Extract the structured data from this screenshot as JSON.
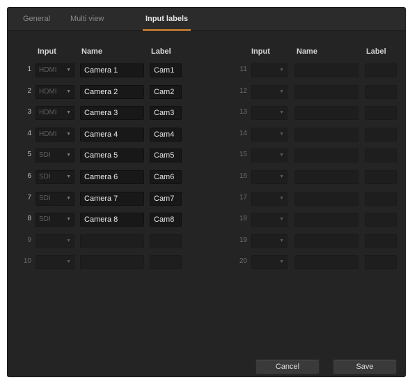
{
  "tabs": [
    {
      "label": "General"
    },
    {
      "label": "Multi view"
    },
    {
      "label": "Input labels"
    }
  ],
  "active_tab": "Input labels",
  "headers": {
    "input": "Input",
    "name": "Name",
    "label": "Label"
  },
  "rows_left": [
    {
      "num": "1",
      "input": "HDMI",
      "name": "Camera 1",
      "label": "Cam1"
    },
    {
      "num": "2",
      "input": "HDMI",
      "name": "Camera 2",
      "label": "Cam2"
    },
    {
      "num": "3",
      "input": "HDMI",
      "name": "Camera 3",
      "label": "Cam3"
    },
    {
      "num": "4",
      "input": "HDMI",
      "name": "Camera 4",
      "label": "Cam4"
    },
    {
      "num": "5",
      "input": "SDI",
      "name": "Camera 5",
      "label": "Cam5"
    },
    {
      "num": "6",
      "input": "SDI",
      "name": "Camera 6",
      "label": "Cam6"
    },
    {
      "num": "7",
      "input": "SDI",
      "name": "Camera 7",
      "label": "Cam7"
    },
    {
      "num": "8",
      "input": "SDI",
      "name": "Camera 8",
      "label": "Cam8"
    },
    {
      "num": "9",
      "input": "",
      "name": "",
      "label": ""
    },
    {
      "num": "10",
      "input": "",
      "name": "",
      "label": ""
    }
  ],
  "rows_right": [
    {
      "num": "11",
      "input": "",
      "name": "",
      "label": ""
    },
    {
      "num": "12",
      "input": "",
      "name": "",
      "label": ""
    },
    {
      "num": "13",
      "input": "",
      "name": "",
      "label": ""
    },
    {
      "num": "14",
      "input": "",
      "name": "",
      "label": ""
    },
    {
      "num": "15",
      "input": "",
      "name": "",
      "label": ""
    },
    {
      "num": "16",
      "input": "",
      "name": "",
      "label": ""
    },
    {
      "num": "17",
      "input": "",
      "name": "",
      "label": ""
    },
    {
      "num": "18",
      "input": "",
      "name": "",
      "label": ""
    },
    {
      "num": "19",
      "input": "",
      "name": "",
      "label": ""
    },
    {
      "num": "20",
      "input": "",
      "name": "",
      "label": ""
    }
  ],
  "buttons": {
    "cancel": "Cancel",
    "save": "Save"
  },
  "colors": {
    "accent": "#e08a2a",
    "background": "#242424"
  },
  "icons": {
    "dropdown": "chevron-down-icon"
  }
}
